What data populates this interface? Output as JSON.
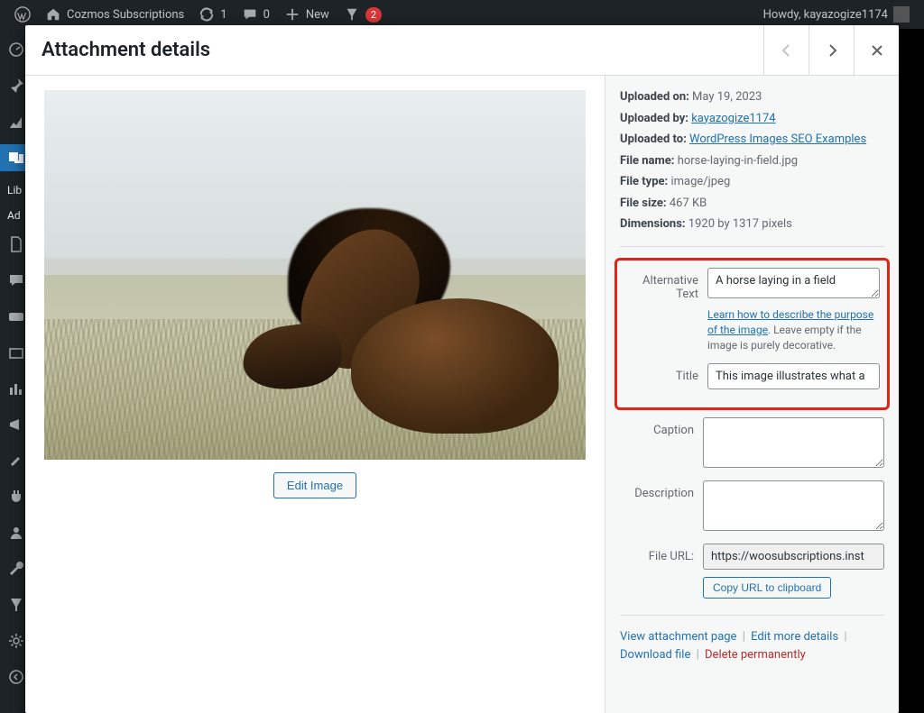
{
  "adminbar": {
    "site_name": "Cozmos Subscriptions",
    "updates_count": "1",
    "comments_count": "0",
    "new_label": "New",
    "yoast_count": "2",
    "howdy": "Howdy, kayazogize1174"
  },
  "sidebar_cut": {
    "library": "Lib",
    "add": "Ad"
  },
  "modal": {
    "title": "Attachment details",
    "prev_aria": "Previous",
    "next_aria": "Next",
    "close_aria": "Close"
  },
  "meta": {
    "uploaded_on_label": "Uploaded on:",
    "uploaded_on": "May 19, 2023",
    "uploaded_by_label": "Uploaded by:",
    "uploaded_by": "kayazogize1174",
    "uploaded_to_label": "Uploaded to:",
    "uploaded_to": "WordPress Images SEO Examples",
    "file_name_label": "File name:",
    "file_name": "horse-laying-in-field.jpg",
    "file_type_label": "File type:",
    "file_type": "image/jpeg",
    "file_size_label": "File size:",
    "file_size": "467 KB",
    "dimensions_label": "Dimensions:",
    "dimensions": "1920 by 1317 pixels"
  },
  "fields": {
    "alt_label": "Alternative Text",
    "alt_value": "A horse laying in a field",
    "alt_help_link": "Learn how to describe the purpose of the image",
    "alt_help_rest": ". Leave empty if the image is purely decorative.",
    "title_label": "Title",
    "title_value": "This image illustrates what a",
    "caption_label": "Caption",
    "caption_value": "",
    "description_label": "Description",
    "description_value": "",
    "file_url_label": "File URL:",
    "file_url_value": "https://woosubscriptions.inst",
    "copy_url_label": "Copy URL to clipboard"
  },
  "buttons": {
    "edit_image": "Edit Image"
  },
  "actions": {
    "view_page": "View attachment page",
    "edit_more": "Edit more details",
    "download": "Download file",
    "delete": "Delete permanently"
  }
}
